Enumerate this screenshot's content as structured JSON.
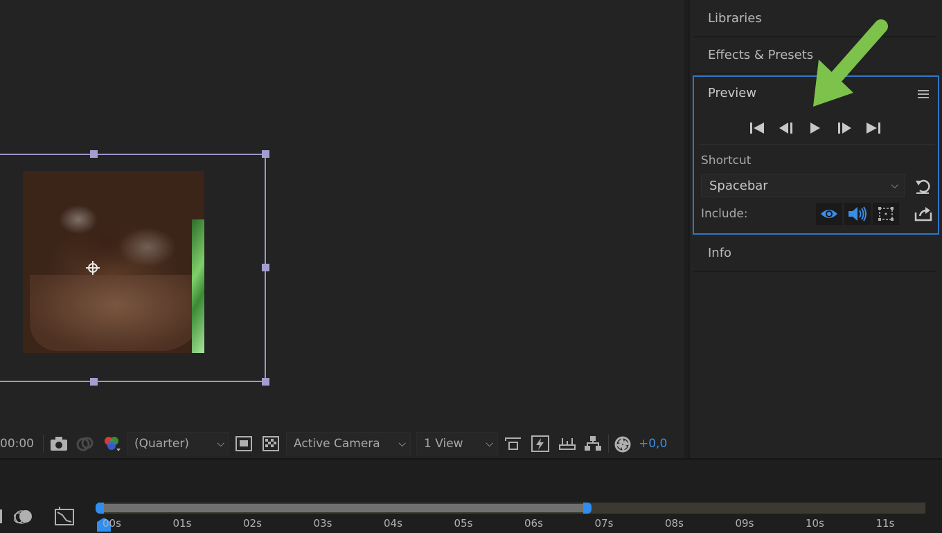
{
  "viewer": {
    "timecode": "00:00",
    "resolution": "(Quarter)",
    "camera": "Active Camera",
    "views": "1 View",
    "exposure": "+0,0"
  },
  "panels": {
    "libraries": "Libraries",
    "effects": "Effects & Presets",
    "info": "Info",
    "preview": {
      "title": "Preview",
      "shortcut_label": "Shortcut",
      "shortcut_value": "Spacebar",
      "include_label": "Include:"
    }
  },
  "timeline": {
    "ticks": [
      "00s",
      "01s",
      "02s",
      "03s",
      "04s",
      "05s",
      "06s",
      "07s",
      "08s",
      "09s",
      "10s",
      "11s"
    ]
  },
  "colors": {
    "accent_blue": "#2f77c6",
    "arrow_green": "#7dc24a",
    "selection": "#9f98c8"
  }
}
